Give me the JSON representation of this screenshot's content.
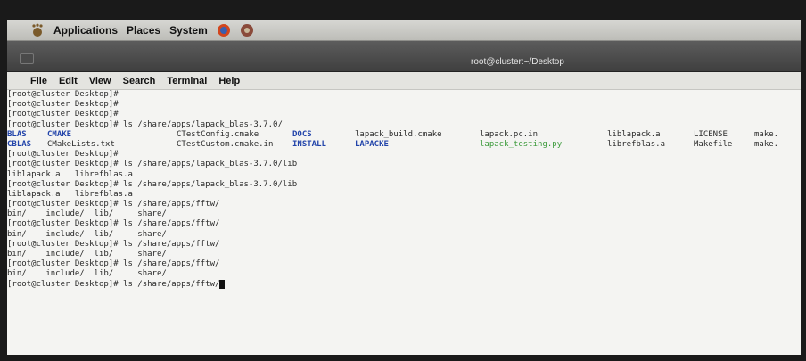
{
  "panel": {
    "menus": [
      "Applications",
      "Places",
      "System"
    ],
    "launchers": [
      "firefox-icon",
      "settings-icon"
    ]
  },
  "window": {
    "title": "root@cluster:~/Desktop",
    "menu": [
      "File",
      "Edit",
      "View",
      "Search",
      "Terminal",
      "Help"
    ]
  },
  "terminal": {
    "lines": [
      {
        "prompt": "[root@cluster Desktop]# ",
        "cmd": ""
      },
      {
        "prompt": "[root@cluster Desktop]# ",
        "cmd": ""
      },
      {
        "prompt": "[root@cluster Desktop]# ",
        "cmd": ""
      },
      {
        "prompt": "[root@cluster Desktop]# ",
        "cmd": "ls /share/apps/lapack_blas-3.7.0/"
      }
    ],
    "listing": {
      "row1": [
        "BLAS",
        "CMAKE",
        "CTestConfig.cmake",
        "DOCS",
        "lapack_build.cmake",
        "lapack.pc.in",
        "liblapack.a",
        "LICENSE",
        "make."
      ],
      "row2": [
        "CBLAS",
        "CMakeLists.txt",
        "CTestCustom.cmake.in",
        "INSTALL",
        "LAPACKE",
        "lapack_testing.py",
        "librefblas.a",
        "Makefile",
        "make."
      ]
    },
    "after": [
      {
        "prompt": "[root@cluster Desktop]# ",
        "cmd": ""
      },
      {
        "prompt": "[root@cluster Desktop]# ",
        "cmd": "ls /share/apps/lapack_blas-3.7.0/lib"
      },
      {
        "text": "liblapack.a   librefblas.a"
      },
      {
        "prompt": "[root@cluster Desktop]# ",
        "cmd": "ls /share/apps/lapack_blas-3.7.0/lib"
      },
      {
        "text": "liblapack.a   librefblas.a"
      },
      {
        "prompt": "[root@cluster Desktop]# ",
        "cmd": "ls /share/apps/fftw/"
      },
      {
        "text": "bin/    include/  lib/     share/"
      },
      {
        "prompt": "[root@cluster Desktop]# ",
        "cmd": "ls /share/apps/fftw/"
      },
      {
        "text": "bin/    include/  lib/     share/"
      },
      {
        "prompt": "[root@cluster Desktop]# ",
        "cmd": "ls /share/apps/fftw/"
      },
      {
        "text": "bin/    include/  lib/     share/"
      },
      {
        "prompt": "[root@cluster Desktop]# ",
        "cmd": "ls /share/apps/fftw/"
      },
      {
        "text": "bin/    include/  lib/     share/"
      },
      {
        "prompt": "[root@cluster Desktop]# ",
        "cmd": "ls /share/apps/fftw/"
      }
    ]
  },
  "colors": {
    "directory": "#2244aa",
    "executable": "#3a9a3a",
    "terminal_bg": "#f4f4f2",
    "title_bar": "#4a4a4a"
  }
}
